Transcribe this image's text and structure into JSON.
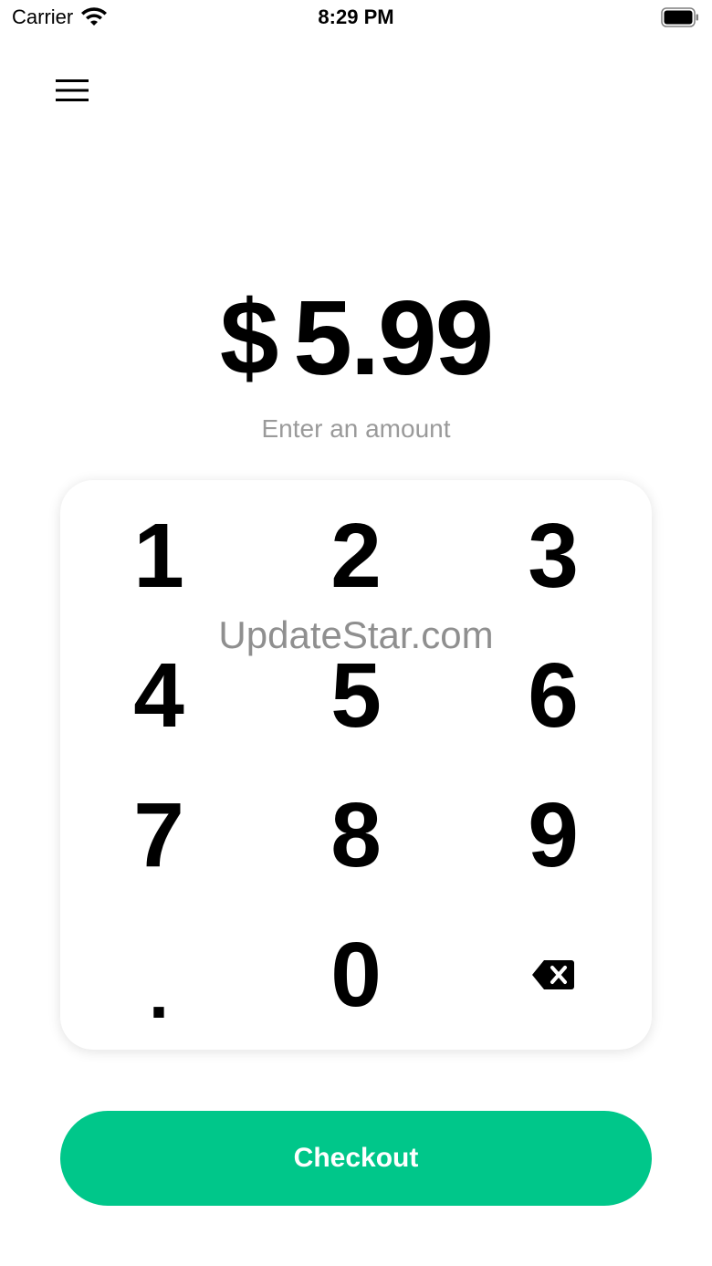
{
  "status_bar": {
    "carrier": "Carrier",
    "time": "8:29 PM",
    "icons": [
      "wifi-icon",
      "battery-icon"
    ]
  },
  "header": {
    "menu_icon": "hamburger-menu-icon"
  },
  "amount": {
    "currency": "$",
    "value": "5.99",
    "hint": "Enter an amount"
  },
  "keypad": {
    "keys": [
      "1",
      "2",
      "3",
      "4",
      "5",
      "6",
      "7",
      "8",
      "9",
      ".",
      "0"
    ],
    "backspace_icon": "backspace-icon"
  },
  "watermark": "UpdateStar.com",
  "checkout": {
    "label": "Checkout",
    "color": "#00c78a"
  }
}
